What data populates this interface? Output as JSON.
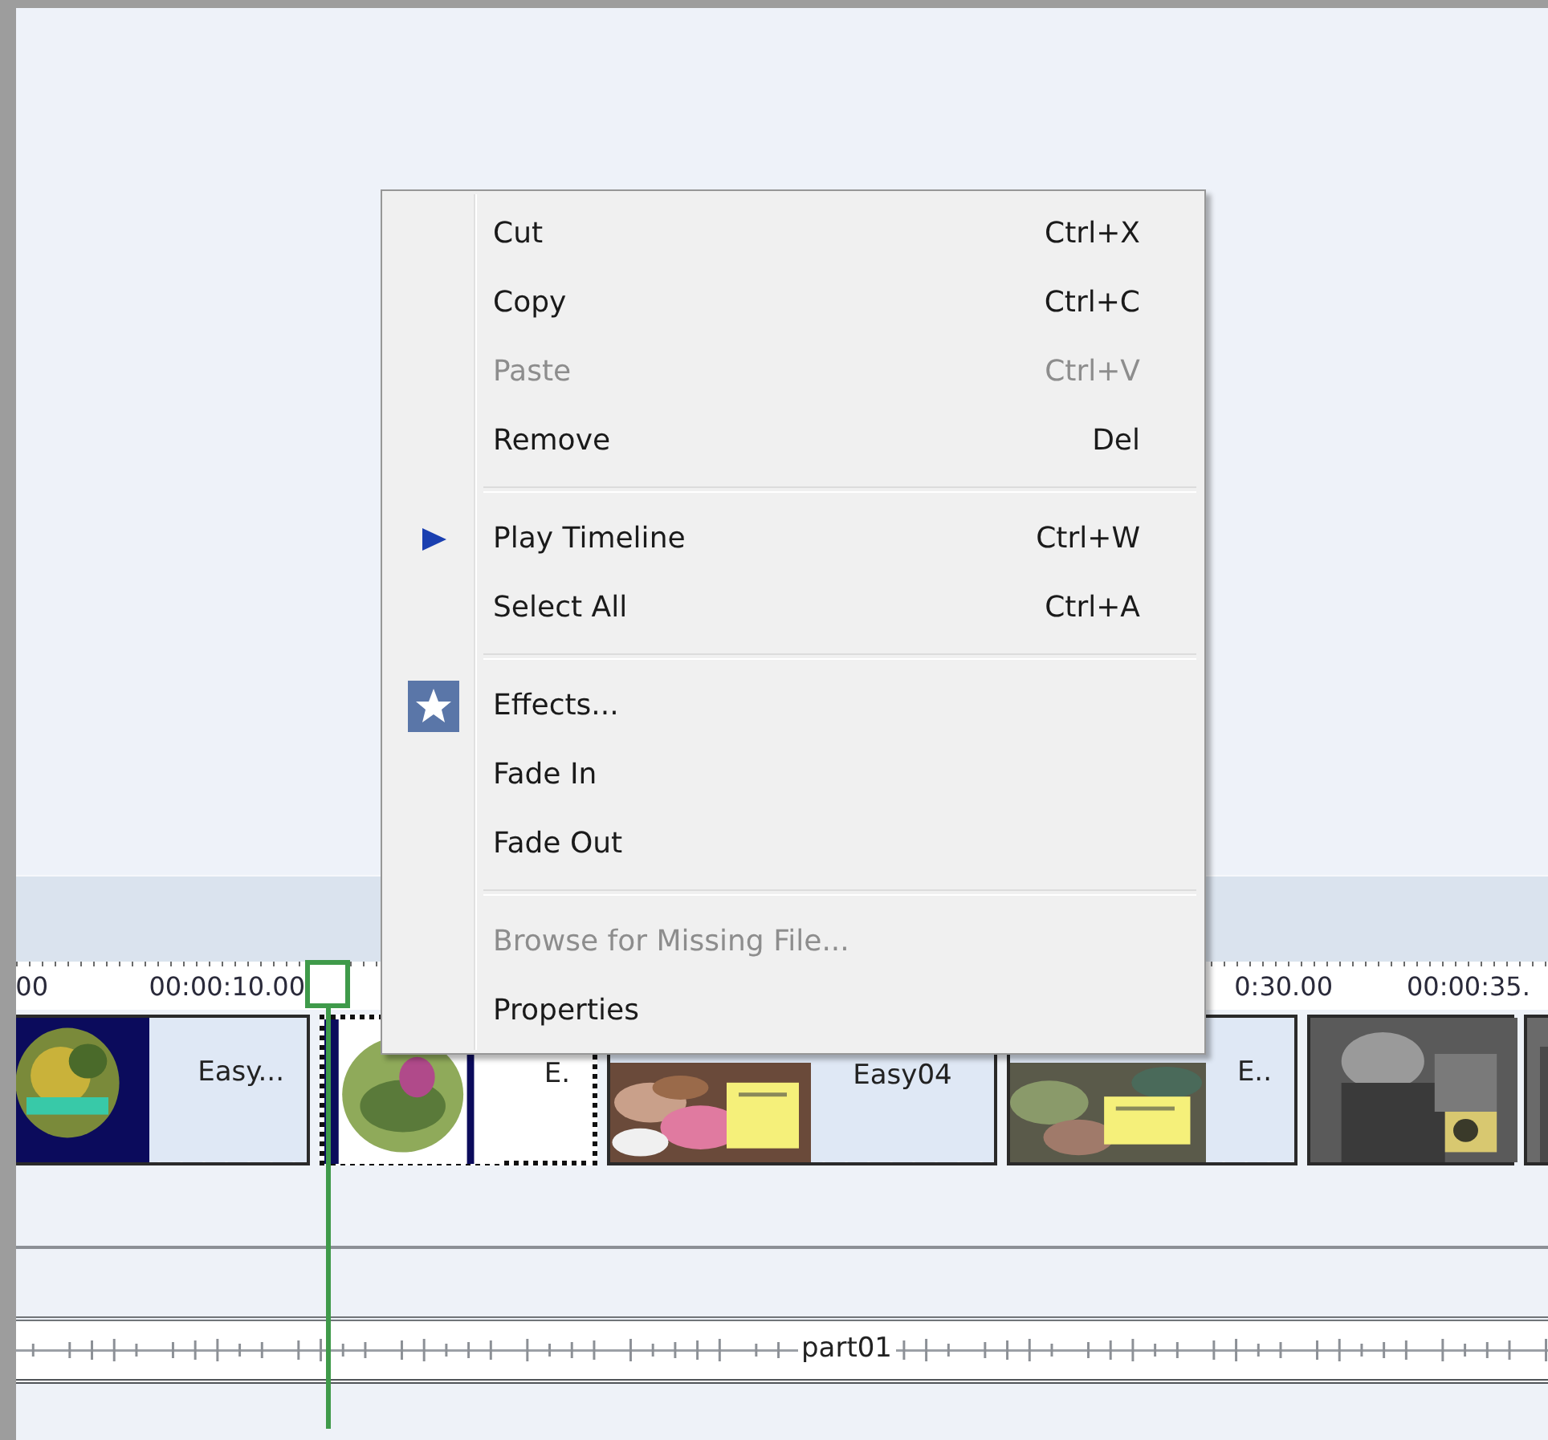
{
  "context_menu": {
    "items": [
      {
        "kind": "item",
        "label": "Cut",
        "shortcut": "Ctrl+X",
        "disabled": false
      },
      {
        "kind": "item",
        "label": "Copy",
        "shortcut": "Ctrl+C",
        "disabled": false
      },
      {
        "kind": "item",
        "label": "Paste",
        "shortcut": "Ctrl+V",
        "disabled": true
      },
      {
        "kind": "item",
        "label": "Remove",
        "shortcut": "Del",
        "disabled": false
      },
      {
        "kind": "separator"
      },
      {
        "kind": "play_item",
        "label": "Play Timeline",
        "shortcut": "Ctrl+W",
        "disabled": false
      },
      {
        "kind": "item",
        "label": "Select All",
        "shortcut": "Ctrl+A",
        "disabled": false
      },
      {
        "kind": "separator"
      },
      {
        "kind": "star_item",
        "label": "Effects...",
        "disabled": false
      },
      {
        "kind": "item",
        "label": "Fade In",
        "disabled": false
      },
      {
        "kind": "item",
        "label": "Fade Out",
        "disabled": false
      },
      {
        "kind": "separator"
      },
      {
        "kind": "item",
        "label": "Browse for Missing File...",
        "disabled": true
      },
      {
        "kind": "item",
        "label": "Properties",
        "disabled": false
      }
    ]
  },
  "timeline": {
    "ruler_labels": [
      "00",
      "00:00:10.00",
      "0:30.00",
      "00:00:35."
    ],
    "clips": [
      {
        "label": "Easy...",
        "selected": false
      },
      {
        "label": "E.",
        "selected": true
      },
      {
        "label": "Easy04",
        "selected": false
      },
      {
        "label": "E..",
        "selected": false
      },
      {
        "selected": false
      },
      {
        "selected": false
      }
    ],
    "audio_track": {
      "label": "part01"
    }
  }
}
